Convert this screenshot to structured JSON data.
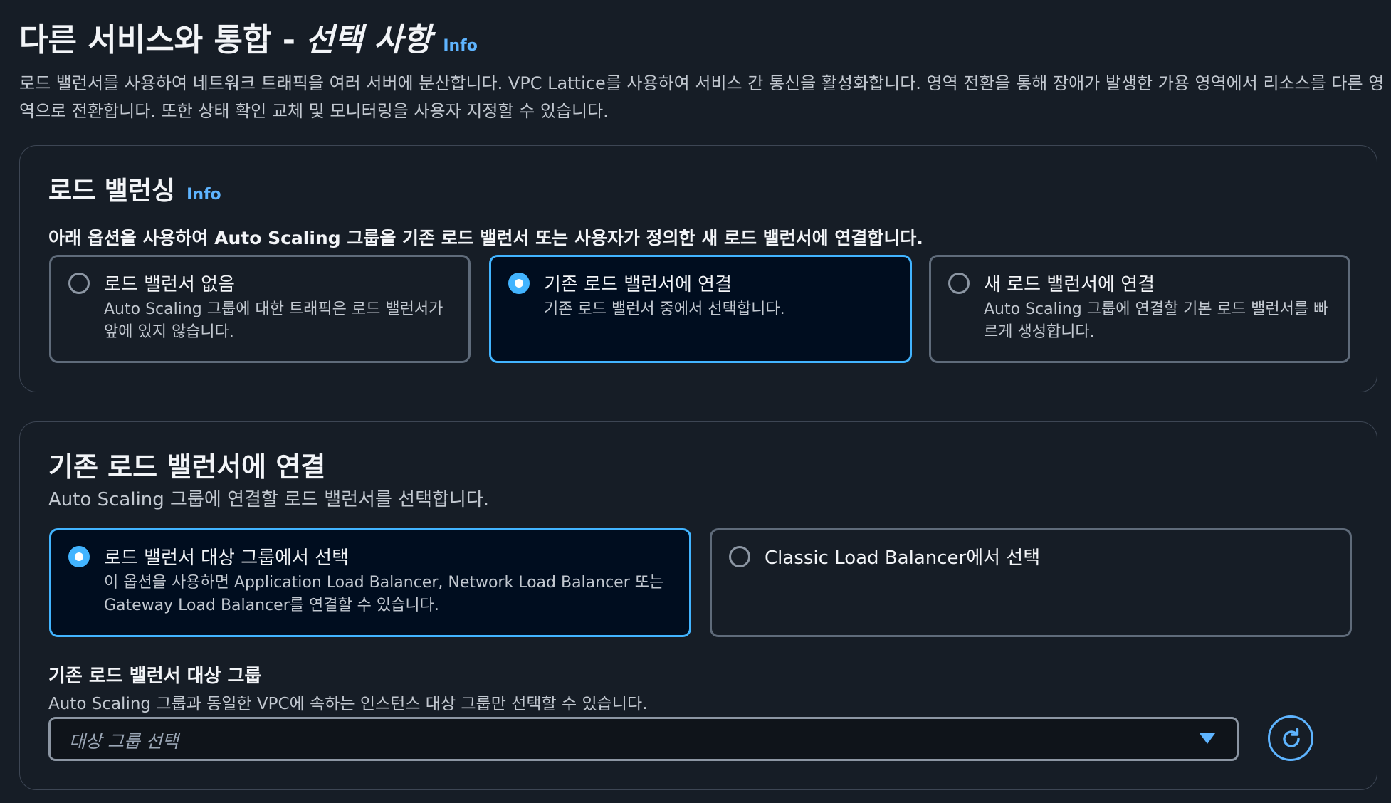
{
  "header": {
    "title": "다른 서비스와 통합 -",
    "title_italic": "선택 사항",
    "info": "Info",
    "description": "로드 밸런서를 사용하여 네트워크 트래픽을 여러 서버에 분산합니다. VPC Lattice를 사용하여 서비스 간 통신을 활성화합니다. 영역 전환을 통해 장애가 발생한 가용 영역에서 리소스를 다른 영역으로 전환합니다. 또한 상태 확인 교체 및 모니터링을 사용자 지정할 수 있습니다."
  },
  "load_balancing": {
    "title": "로드 밸런싱",
    "info": "Info",
    "instruction": "아래 옵션을 사용하여 Auto Scaling 그룹을 기존 로드 밸런서 또는 사용자가 정의한 새 로드 밸런서에 연결합니다.",
    "options": [
      {
        "label": "로드 밸런서 없음",
        "desc": "Auto Scaling 그룹에 대한 트래픽은 로드 밸런서가 앞에 있지 않습니다.",
        "selected": false
      },
      {
        "label": "기존 로드 밸런서에 연결",
        "desc": "기존 로드 밸런서 중에서 선택합니다.",
        "selected": true
      },
      {
        "label": "새 로드 밸런서에 연결",
        "desc": "Auto Scaling 그룹에 연결할 기본 로드 밸런서를 빠르게 생성합니다.",
        "selected": false
      }
    ]
  },
  "attach_existing": {
    "title": "기존 로드 밸런서에 연결",
    "subtitle": "Auto Scaling 그룹에 연결할 로드 밸런서를 선택합니다.",
    "options": [
      {
        "label": "로드 밸런서 대상 그룹에서 선택",
        "desc": "이 옵션을 사용하면 Application Load Balancer, Network Load Balancer 또는 Gateway Load Balancer를 연결할 수 있습니다.",
        "selected": true
      },
      {
        "label": "Classic Load Balancer에서 선택",
        "desc": "",
        "selected": false
      }
    ],
    "field_label": "기존 로드 밸런서 대상 그룹",
    "field_hint": "Auto Scaling 그룹과 동일한 VPC에 속하는 인스턴스 대상 그룹만 선택할 수 있습니다.",
    "select_placeholder": "대상 그룹 선택"
  },
  "colors": {
    "background": "#161d26",
    "accent": "#42b4ff",
    "link": "#5eb4ff",
    "selected_tile_bg": "#000d1f"
  },
  "icons": [
    "radio-icon",
    "chevron-down-icon",
    "refresh-icon"
  ]
}
